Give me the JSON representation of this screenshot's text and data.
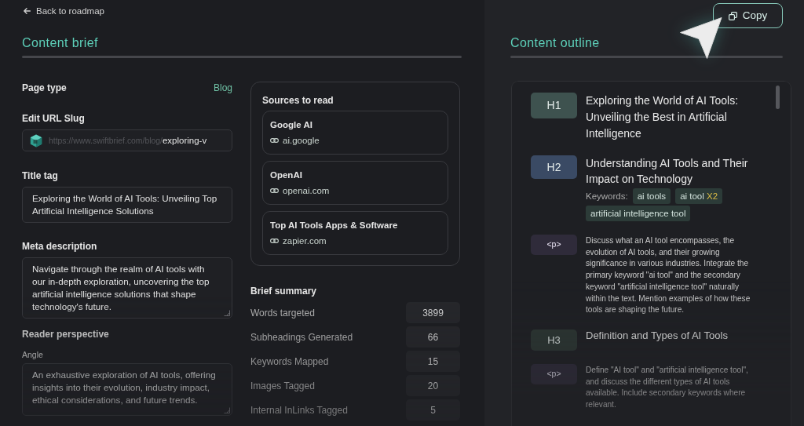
{
  "back_link": {
    "label": "Back to roadmap"
  },
  "content_brief": {
    "title": "Content brief",
    "page_type": {
      "label": "Page type",
      "value": "Blog"
    },
    "url_slug": {
      "label": "Edit URL Slug",
      "prefix": "https://www.swiftbrief.com/blog/",
      "value": "exploring-v"
    },
    "title_tag": {
      "label": "Title tag",
      "value": "Exploring the World of AI Tools: Unveiling Top Artificial Intelligence Solutions"
    },
    "meta_description": {
      "label": "Meta description",
      "value": "Navigate through the realm of AI tools with our in-depth exploration, uncovering the top artificial intelligence solutions that shape technology's future."
    },
    "reader_perspective": {
      "label": "Reader perspective",
      "angle": {
        "label": "Angle",
        "value": "An exhaustive exploration of AI tools, offering insights into their evolution, industry impact, ethical considerations, and future trends."
      }
    },
    "sources": {
      "title": "Sources to read",
      "items": [
        {
          "name": "Google AI",
          "domain": "ai.google"
        },
        {
          "name": "OpenAI",
          "domain": "openai.com"
        },
        {
          "name": "Top AI Tools Apps & Software",
          "domain": "zapier.com"
        }
      ]
    },
    "brief_summary": {
      "title": "Brief summary",
      "rows": [
        {
          "label": "Words targeted",
          "value": "3899"
        },
        {
          "label": "Subheadings Generated",
          "value": "66"
        },
        {
          "label": "Keywords Mapped",
          "value": "15"
        },
        {
          "label": "Images Tagged",
          "value": "20"
        },
        {
          "label": "Internal InLinks Tagged",
          "value": "5"
        }
      ]
    }
  },
  "copy_button": {
    "label": "Copy"
  },
  "content_outline": {
    "title": "Content outline",
    "items": [
      {
        "kind": "h1",
        "tag": "H1",
        "text": "Exploring the World of AI Tools: Unveiling the Best in Artificial Intelligence"
      },
      {
        "kind": "h2",
        "tag": "H2",
        "text": "Understanding AI Tools and Their Impact on Technology",
        "keywords_label": "Keywords:",
        "keywords": [
          {
            "text": "ai tools"
          },
          {
            "text": "ai tool",
            "count": "X2"
          },
          {
            "text": "artificial intelligence tool"
          }
        ]
      },
      {
        "kind": "p",
        "tag": "<p>",
        "text": "Discuss what an AI tool encompasses, the evolution of AI tools, and their growing significance in various industries. Integrate the primary keyword \"ai tool\" and the secondary keyword \"artificial intelligence tool\" naturally within the text. Mention examples of how these tools are shaping the future."
      },
      {
        "kind": "h3",
        "tag": "H3",
        "text": "Definition and Types of AI Tools"
      },
      {
        "kind": "p",
        "tag": "<p>",
        "text": "Define \"AI tool\" and \"artificial intelligence tool\", and discuss the different types of AI tools available. Include secondary keywords where relevant."
      }
    ]
  }
}
